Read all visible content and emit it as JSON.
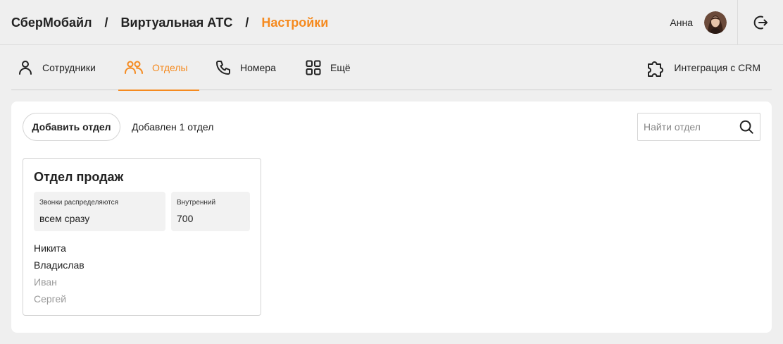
{
  "header": {
    "breadcrumb": [
      "СберМобайл",
      "Виртуальная АТС",
      "Настройки"
    ],
    "separator": "/",
    "user_name": "Анна",
    "logout_icon": "logout-icon"
  },
  "nav": {
    "tabs": [
      {
        "label": "Сотрудники",
        "icon": "user-icon",
        "active": false
      },
      {
        "label": "Отделы",
        "icon": "users-group-icon",
        "active": true
      },
      {
        "label": "Номера",
        "icon": "phone-icon",
        "active": false
      },
      {
        "label": "Ещё",
        "icon": "grid-icon",
        "active": false
      }
    ],
    "crm": {
      "label": "Интеграция с CRM",
      "icon": "puzzle-icon"
    }
  },
  "toolbar": {
    "add_label": "Добавить отдел",
    "added_text": "Добавлен 1 отдел",
    "search_placeholder": "Найти отдел"
  },
  "department": {
    "title": "Отдел продаж",
    "distribution_label": "Звонки распределяются",
    "distribution_value": "всем сразу",
    "internal_label": "Внутренний",
    "internal_value": "700",
    "members": [
      {
        "name": "Никита",
        "active": true
      },
      {
        "name": "Владислав",
        "active": true
      },
      {
        "name": "Иван",
        "active": false
      },
      {
        "name": "Сергей",
        "active": false
      }
    ]
  },
  "colors": {
    "accent": "#f58a1f",
    "text": "#222222",
    "muted": "#9a9a9a",
    "background": "#efefef"
  }
}
